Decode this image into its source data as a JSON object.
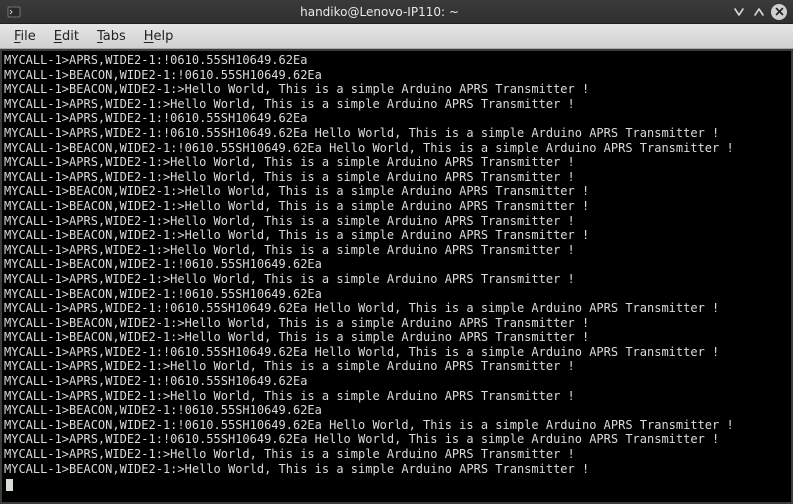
{
  "window": {
    "title": "handiko@Lenovo-IP110: ~"
  },
  "menu": {
    "items": [
      {
        "accel": "F",
        "rest": "ile"
      },
      {
        "accel": "E",
        "rest": "dit"
      },
      {
        "accel": "T",
        "rest": "abs"
      },
      {
        "accel": "H",
        "rest": "elp"
      }
    ]
  },
  "terminal": {
    "lines": [
      "MYCALL-1>APRS,WIDE2-1:!0610.55SH10649.62Ea",
      "MYCALL-1>BEACON,WIDE2-1:!0610.55SH10649.62Ea",
      "MYCALL-1>BEACON,WIDE2-1:>Hello World, This is a simple Arduino APRS Transmitter !",
      "MYCALL-1>APRS,WIDE2-1:>Hello World, This is a simple Arduino APRS Transmitter !",
      "MYCALL-1>APRS,WIDE2-1:!0610.55SH10649.62Ea",
      "MYCALL-1>APRS,WIDE2-1:!0610.55SH10649.62Ea Hello World, This is a simple Arduino APRS Transmitter !",
      "MYCALL-1>BEACON,WIDE2-1:!0610.55SH10649.62Ea Hello World, This is a simple Arduino APRS Transmitter !",
      "MYCALL-1>APRS,WIDE2-1:>Hello World, This is a simple Arduino APRS Transmitter !",
      "MYCALL-1>APRS,WIDE2-1:>Hello World, This is a simple Arduino APRS Transmitter !",
      "MYCALL-1>BEACON,WIDE2-1:>Hello World, This is a simple Arduino APRS Transmitter !",
      "MYCALL-1>BEACON,WIDE2-1:>Hello World, This is a simple Arduino APRS Transmitter !",
      "MYCALL-1>APRS,WIDE2-1:>Hello World, This is a simple Arduino APRS Transmitter !",
      "MYCALL-1>BEACON,WIDE2-1:>Hello World, This is a simple Arduino APRS Transmitter !",
      "MYCALL-1>APRS,WIDE2-1:>Hello World, This is a simple Arduino APRS Transmitter !",
      "MYCALL-1>BEACON,WIDE2-1:!0610.55SH10649.62Ea",
      "MYCALL-1>APRS,WIDE2-1:>Hello World, This is a simple Arduino APRS Transmitter !",
      "MYCALL-1>BEACON,WIDE2-1:!0610.55SH10649.62Ea",
      "MYCALL-1>APRS,WIDE2-1:!0610.55SH10649.62Ea Hello World, This is a simple Arduino APRS Transmitter !",
      "MYCALL-1>BEACON,WIDE2-1:>Hello World, This is a simple Arduino APRS Transmitter !",
      "MYCALL-1>BEACON,WIDE2-1:>Hello World, This is a simple Arduino APRS Transmitter !",
      "MYCALL-1>APRS,WIDE2-1:!0610.55SH10649.62Ea Hello World, This is a simple Arduino APRS Transmitter !",
      "MYCALL-1>APRS,WIDE2-1:>Hello World, This is a simple Arduino APRS Transmitter !",
      "MYCALL-1>APRS,WIDE2-1:!0610.55SH10649.62Ea",
      "MYCALL-1>APRS,WIDE2-1:>Hello World, This is a simple Arduino APRS Transmitter !",
      "MYCALL-1>BEACON,WIDE2-1:!0610.55SH10649.62Ea",
      "MYCALL-1>BEACON,WIDE2-1:!0610.55SH10649.62Ea Hello World, This is a simple Arduino APRS Transmitter !",
      "MYCALL-1>APRS,WIDE2-1:!0610.55SH10649.62Ea Hello World, This is a simple Arduino APRS Transmitter !",
      "MYCALL-1>APRS,WIDE2-1:>Hello World, This is a simple Arduino APRS Transmitter !",
      "MYCALL-1>BEACON,WIDE2-1:>Hello World, This is a simple Arduino APRS Transmitter !"
    ]
  }
}
